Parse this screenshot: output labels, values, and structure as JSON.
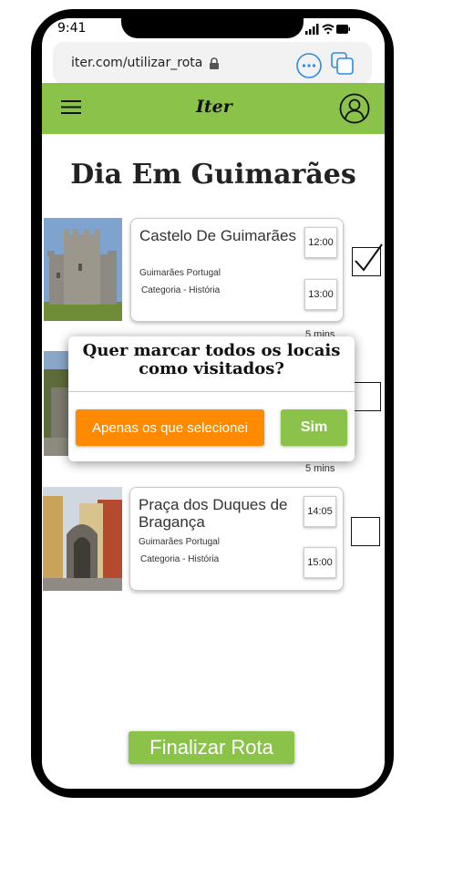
{
  "status_bar": {
    "time": "9:41"
  },
  "browser": {
    "url": "iter.com/utilizar_rota"
  },
  "header": {
    "logo": "Iter"
  },
  "page_title": "Dia Em Guimarães",
  "stops": [
    {
      "name": "Castelo De Guimarães",
      "location": "Guimarães Portugal",
      "category": "Categoria - História",
      "start": "12:00",
      "end": "13:00",
      "checked": true,
      "duration_after": "5 mins"
    },
    {
      "name": "",
      "location": "",
      "category": "",
      "start": "",
      "end": "",
      "checked": false,
      "duration_after": "5 mins"
    },
    {
      "name": "Praça dos Duques de Bragança",
      "location": "Guimarães Portugal",
      "category": "Categoria - História",
      "start": "14:05",
      "end": "15:00",
      "checked": false
    }
  ],
  "modal": {
    "title": "Quer marcar todos os locais como visitados?",
    "button_selected": "Apenas os que selecionei",
    "button_yes": "Sim"
  },
  "finalize_button": "Finalizar Rota",
  "colors": {
    "accent": "#8bc34a",
    "orange": "#ff8a00"
  }
}
